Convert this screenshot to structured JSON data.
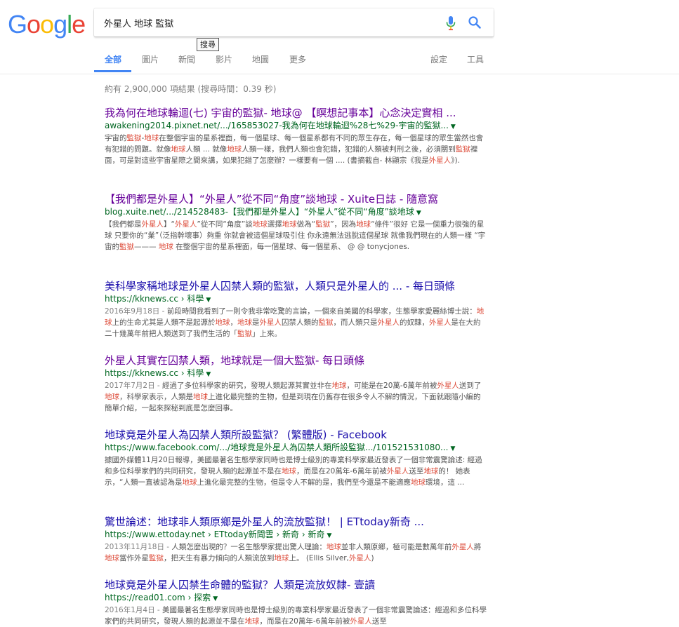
{
  "logo": {
    "letters": [
      "G",
      "o",
      "o",
      "g",
      "l",
      "e"
    ],
    "colors": [
      "#4285f4",
      "#ea4335",
      "#fbbc05",
      "#4285f4",
      "#34a853",
      "#ea4335"
    ]
  },
  "search": {
    "query": "外星人 地球 監獄",
    "tooltip": "搜尋"
  },
  "tabs": [
    {
      "label": "全部",
      "active": true
    },
    {
      "label": "圖片"
    },
    {
      "label": "新聞"
    },
    {
      "label": "影片"
    },
    {
      "label": "地圖"
    },
    {
      "label": "更多"
    }
  ],
  "tools": {
    "settings": "設定",
    "tools": "工具"
  },
  "stats": "約有 2,900,000 項結果 (搜尋時間：0.39 秒)",
  "results": [
    {
      "title": "我為何在地球輪迴(七) 宇宙的監獄- 地球@ 【瞑想記事本】心念決定實相 ...",
      "visited": true,
      "url": "awakening2014.pixnet.net/.../165853027-我為何在地球輪迴%28七%29-宇宙的監獄...",
      "snippet": [
        {
          "t": "宇宙的"
        },
        {
          "t": "監獄",
          "h": 1
        },
        {
          "t": "-"
        },
        {
          "t": "地球",
          "h": 1
        },
        {
          "t": "在整個宇宙的星系裡面，每一個星球、每一個星系都有不同的眾生存在，每一個星球的眾生當然也會有犯錯的問題。就像"
        },
        {
          "t": "地球",
          "h": 1
        },
        {
          "t": "人類 ... 就像"
        },
        {
          "t": "地球",
          "h": 1
        },
        {
          "t": "人類一樣，我們人類也會犯錯，犯錯的人類被判刑之後，必須關到"
        },
        {
          "t": "監獄",
          "h": 1
        },
        {
          "t": "裡面，可是對這些宇宙星際之間來講，如果犯錯了怎麼辦？一樣要有一個 .... (書摘截自- 林顯宗《我是"
        },
        {
          "t": "外星人",
          "h": 1
        },
        {
          "t": "》)."
        }
      ]
    },
    {
      "title": "【我們都是外星人】“外星人”從不同“角度”談地球 - Xuite日誌 - 隨意窩",
      "visited": true,
      "url": "blog.xuite.net/.../214528483-【我們都是外星人】“外星人”從不同“角度”談地球",
      "snippet": [
        {
          "t": "【我們都是"
        },
        {
          "t": "外星人",
          "h": 1
        },
        {
          "t": "】“"
        },
        {
          "t": "外星人",
          "h": 1
        },
        {
          "t": "”從不同“角度”談"
        },
        {
          "t": "地球",
          "h": 1
        },
        {
          "t": "選擇"
        },
        {
          "t": "地球",
          "h": 1
        },
        {
          "t": "做為“"
        },
        {
          "t": "監獄",
          "h": 1
        },
        {
          "t": "”，因為"
        },
        {
          "t": "地球",
          "h": 1
        },
        {
          "t": "“條件”很好 它是一個重力很強的星球 只要你的“業”（泛指幹壞事）夠重 你就會被這個星球吸引住 你永遠無法逃脫這個星球 就像我們現在的人類一樣 “宇宙的"
        },
        {
          "t": "監獄",
          "h": 1
        },
        {
          "t": "——— "
        },
        {
          "t": "地球",
          "h": 1
        },
        {
          "t": " 在整個宇宙的星系裡面，每一個星球、每一個星系、 @ @ tonycjones."
        }
      ]
    },
    {
      "title": "美科學家稱地球是外星人囚禁人類的監獄，人類只是外星人的 ... - 每日頭條",
      "visited": false,
      "url": "https://kknews.cc › 科學",
      "snippet": [
        {
          "t": "2016年9月18日 - ",
          "d": 1
        },
        {
          "t": "前段時間我看到了一則令我非常吃驚的言論，一個來自美國的科學家，生態學家愛麗絲博士說："
        },
        {
          "t": "地球",
          "h": 1
        },
        {
          "t": "上的生命尤其是人類不是起源於"
        },
        {
          "t": "地球",
          "h": 1
        },
        {
          "t": "，"
        },
        {
          "t": "地球",
          "h": 1
        },
        {
          "t": "是"
        },
        {
          "t": "外星人",
          "h": 1
        },
        {
          "t": "囚禁人類的"
        },
        {
          "t": "監獄",
          "h": 1
        },
        {
          "t": "，而人類只是"
        },
        {
          "t": "外星人",
          "h": 1
        },
        {
          "t": "的奴隸，"
        },
        {
          "t": "外星人",
          "h": 1
        },
        {
          "t": "是在大約二十幾萬年前把人類送到了我們生活的「"
        },
        {
          "t": "監獄",
          "h": 1
        },
        {
          "t": "」上來。"
        }
      ]
    },
    {
      "title": "外星人其實在囚禁人類，地球就是一個大監獄- 每日頭條",
      "visited": true,
      "url": "https://kknews.cc › 科學",
      "snippet": [
        {
          "t": "2017年7月2日 - ",
          "d": 1
        },
        {
          "t": "經過了多位科學家的研究，發現人類起源其實並非在"
        },
        {
          "t": "地球",
          "h": 1
        },
        {
          "t": "，可能是在20萬-6萬年前被"
        },
        {
          "t": "外星人",
          "h": 1
        },
        {
          "t": "送到了"
        },
        {
          "t": "地球",
          "h": 1
        },
        {
          "t": "，科學家表示，人類是"
        },
        {
          "t": "地球",
          "h": 1
        },
        {
          "t": "上進化最完整的生物，但是到現在仍舊存在很多令人不解的情況，下面就跟隨小編的簡單介紹，一起來探秘到底是怎麼回事。"
        }
      ]
    },
    {
      "title": "地球竟是外星人為囚禁人類所設監獄？ (繁體版) - Facebook",
      "visited": false,
      "url": "https://www.facebook.com/.../地球竟是外星人為囚禁人類所設監獄.../101521531080...",
      "snippet": [
        {
          "t": "據國外媒體11月20日報導，美國最著名生態學家同時也是博士級別的專業科學家最近發表了一個非常震驚論述: 經過和多位科學家們的共同研究，發現人類的起源並不是在"
        },
        {
          "t": "地球",
          "h": 1
        },
        {
          "t": "，而是在20萬年-6萬年前被"
        },
        {
          "t": "外星人",
          "h": 1
        },
        {
          "t": "送至"
        },
        {
          "t": "地球",
          "h": 1
        },
        {
          "t": "的！ 她表示，“人類一直被認為是"
        },
        {
          "t": "地球",
          "h": 1
        },
        {
          "t": "上進化最完整的生物，但是令人不解的是，我們至今還是不能適應"
        },
        {
          "t": "地球",
          "h": 1
        },
        {
          "t": "環境，這 ..."
        }
      ]
    },
    {
      "title": "驚世論述：地球非人類原鄉是外星人的流放監獄！ | ETtoday新奇 ...",
      "visited": false,
      "url": "https://www.ettoday.net › ETtoday新聞雲 › 新奇 › 新奇",
      "snippet": [
        {
          "t": "2013年11月18日 - ",
          "d": 1
        },
        {
          "t": "人類怎麼出現的？一名生態學家提出驚人理論："
        },
        {
          "t": "地球",
          "h": 1
        },
        {
          "t": "並非人類原鄉，極可能是數萬年前"
        },
        {
          "t": "外星人",
          "h": 1
        },
        {
          "t": "將"
        },
        {
          "t": "地球",
          "h": 1
        },
        {
          "t": "當作外星"
        },
        {
          "t": "監獄",
          "h": 1
        },
        {
          "t": "，把天生有暴力傾向的人類流放到"
        },
        {
          "t": "地球",
          "h": 1
        },
        {
          "t": "上。 (Ellis Silver,"
        },
        {
          "t": "外星人",
          "h": 1
        },
        {
          "t": ")"
        }
      ]
    },
    {
      "title": "地球竟是外星人囚禁生命體的監獄？人類是流放奴隸- 壹讀",
      "visited": false,
      "url": "https://read01.com › 探索",
      "snippet": [
        {
          "t": "2016年1月4日 - ",
          "d": 1
        },
        {
          "t": "美國最著名生態學家同時也是博士級別的專業科學家最近發表了一個非常震驚論述：經過和多位科學家們的共同研究，發現人類的起源並不是在"
        },
        {
          "t": "地球",
          "h": 1
        },
        {
          "t": "，而是在20萬年-6萬年前被"
        },
        {
          "t": "外星人",
          "h": 1
        },
        {
          "t": "送至"
        }
      ]
    }
  ]
}
